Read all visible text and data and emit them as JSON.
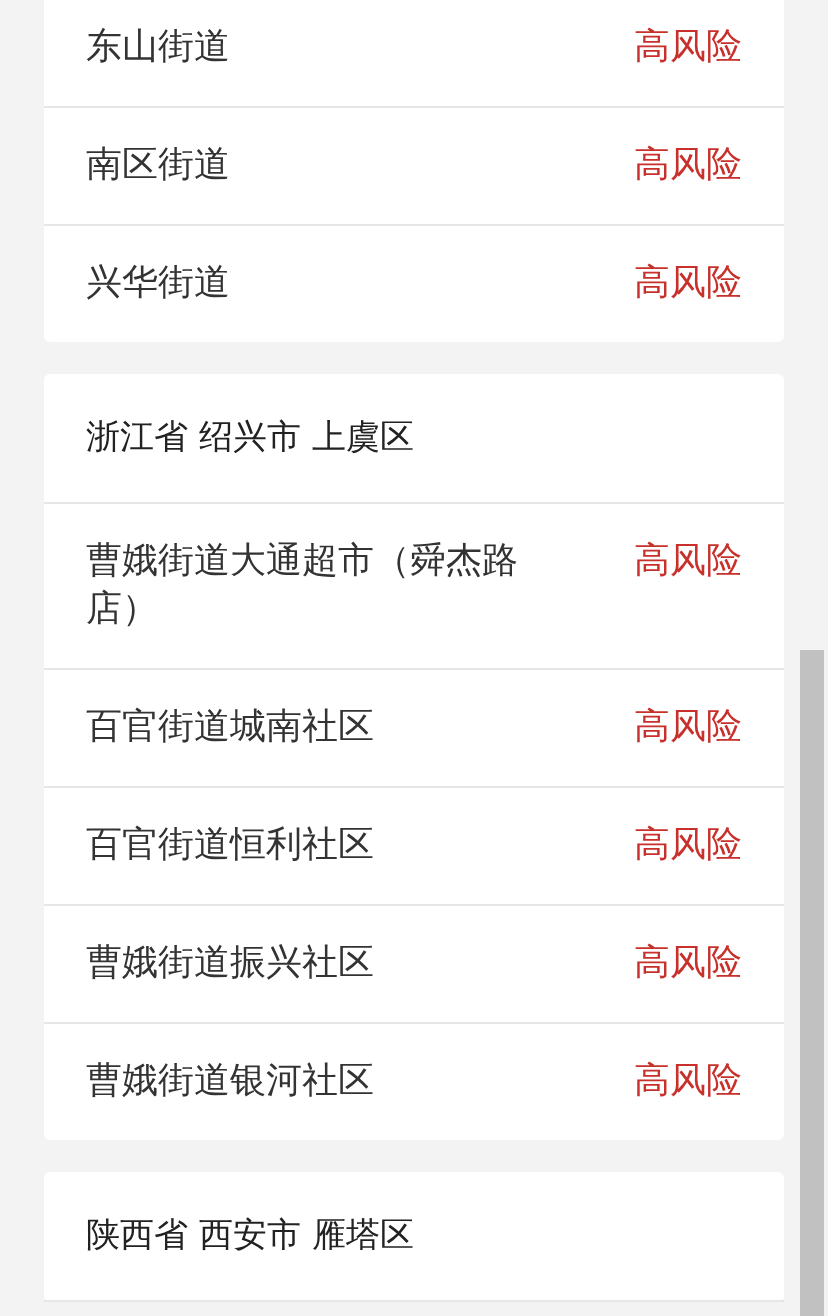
{
  "sections": [
    {
      "rows": [
        {
          "name": "东山街道",
          "risk": "高风险"
        },
        {
          "name": "南区街道",
          "risk": "高风险"
        },
        {
          "name": "兴华街道",
          "risk": "高风险"
        }
      ]
    },
    {
      "header": "浙江省 绍兴市 上虞区",
      "rows": [
        {
          "name": "曹娥街道大通超市（舜杰路店）",
          "risk": "高风险"
        },
        {
          "name": "百官街道城南社区",
          "risk": "高风险"
        },
        {
          "name": "百官街道恒利社区",
          "risk": "高风险"
        },
        {
          "name": "曹娥街道振兴社区",
          "risk": "高风险"
        },
        {
          "name": "曹娥街道银河社区",
          "risk": "高风险"
        }
      ]
    },
    {
      "header": "陕西省 西安市 雁塔区"
    }
  ]
}
